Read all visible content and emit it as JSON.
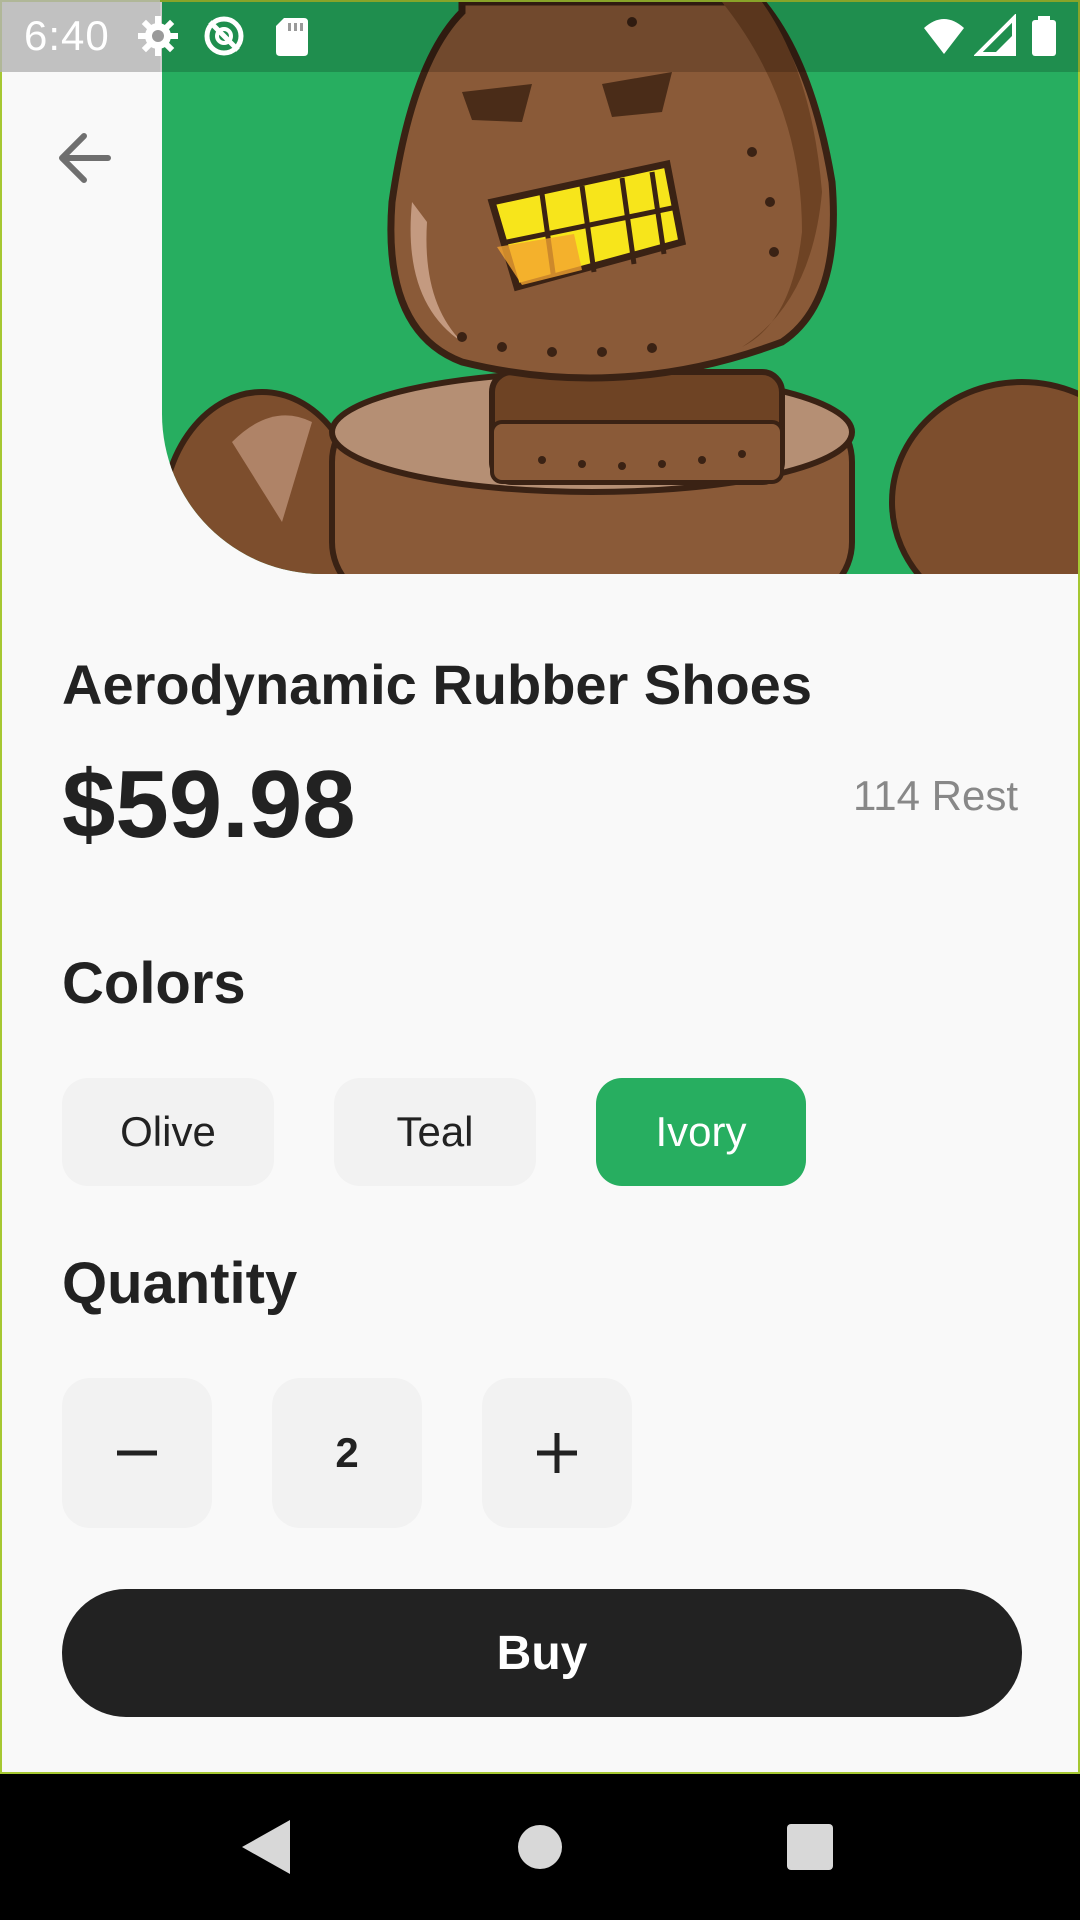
{
  "status_bar": {
    "time": "6:40",
    "left_icons": [
      "settings-icon",
      "no-tracking-icon",
      "sd-card-icon"
    ],
    "right_icons": [
      "wifi-icon",
      "signal-icon",
      "battery-icon"
    ]
  },
  "hero": {
    "image": "robot-character-illustration",
    "background_color": "#27ae60"
  },
  "back_button": {
    "icon": "arrow-back-icon"
  },
  "product": {
    "name": "Aerodynamic Rubber Shoes",
    "price": "$59.98",
    "stock": "114 Rest"
  },
  "colors": {
    "label": "Colors",
    "options": [
      "Olive",
      "Teal",
      "Ivory"
    ],
    "selected": "Ivory",
    "accent": "#27ae60"
  },
  "quantity": {
    "label": "Quantity",
    "value": "2",
    "decrement_icon": "minus-icon",
    "increment_icon": "plus-icon"
  },
  "buy_button": {
    "label": "Buy"
  },
  "nav_bar": {
    "icons": [
      "back-triangle-icon",
      "home-circle-icon",
      "recents-square-icon"
    ]
  }
}
